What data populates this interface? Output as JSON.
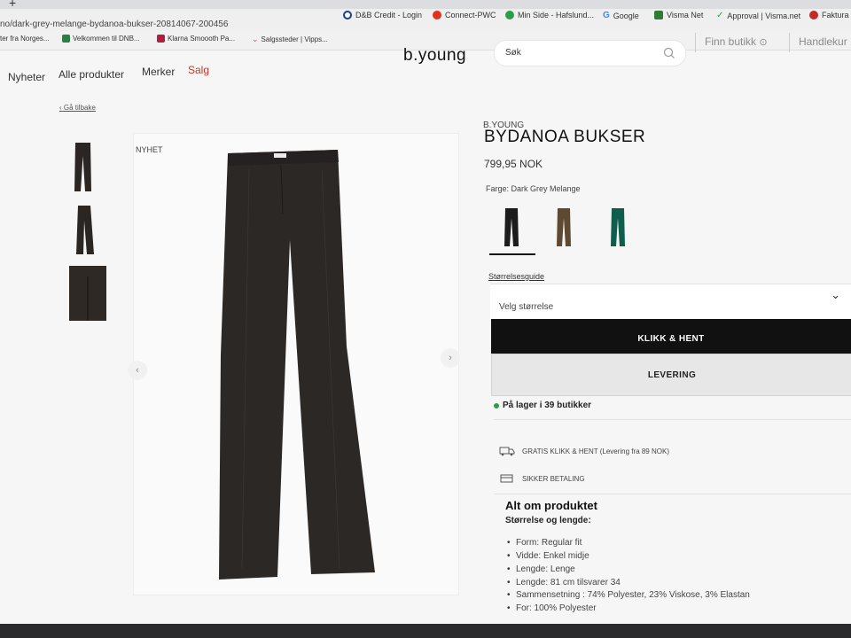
{
  "browser": {
    "new_tab": "+",
    "url": "no/dark-grey-melange-bydanoa-bukser-20814067-200456",
    "top_right_bookmarks": [
      "D&B Credit - Login",
      "Connect-PWC",
      "Min Side - Hafslund...",
      "Google",
      "Visma Net",
      "Approval | Visma.net",
      "Faktura"
    ],
    "bookmarks": [
      "ter fra Norges...",
      "Velkommen til DNB...",
      "Klarna Smoooth Pa...",
      "Salgssteder | Vipps..."
    ],
    "bookmark_colors": [
      "#2d7d46",
      "#2a5fa6",
      "#b01e3c",
      "#d9534f"
    ]
  },
  "header": {
    "logo": "b.young",
    "search_placeholder": "Søk",
    "store_link": "Finn butikk",
    "cart_link": "Handlekur"
  },
  "nav": [
    "Nyheter",
    "Alle produkter",
    "Merker",
    "Salg"
  ],
  "back_link": "Gå tilbake",
  "gallery": {
    "badge": "NYHET",
    "prev_icon": "‹",
    "next_icon": "›"
  },
  "product": {
    "brand": "B.YOUNG",
    "title": "BYDANOA BUKSER",
    "price": "799,95 NOK",
    "color_label": "Farge: Dark Grey Melange",
    "swatch_colors": [
      "#1c1c1c",
      "#5e4a33",
      "#0f5d4c"
    ],
    "size_guide": "Størrelsesguide",
    "size_placeholder": "Velg størrelse",
    "buttons": {
      "click_collect": "KLIKK & HENT",
      "delivery": "LEVERING"
    },
    "stock": "På lager i 39 butikker",
    "perks": [
      "GRATIS KLIKK & HENT (Levering fra 89 NOK)",
      "SIKKER BETALING"
    ],
    "about": {
      "title": "Alt om produktet",
      "subtitle": "Størrelse og lengde:",
      "items": [
        "Form: Regular fit",
        "Vidde: Enkel midje",
        "Lengde: Lenge",
        "Lengde: 81 cm tilsvarer 34",
        "Sammensetning : 74% Polyester, 23% Viskose, 3% Elastan",
        "For: 100% Polyester"
      ]
    }
  },
  "colors": {
    "stock_green": "#2e9d48",
    "sale_red": "#c0392b"
  }
}
